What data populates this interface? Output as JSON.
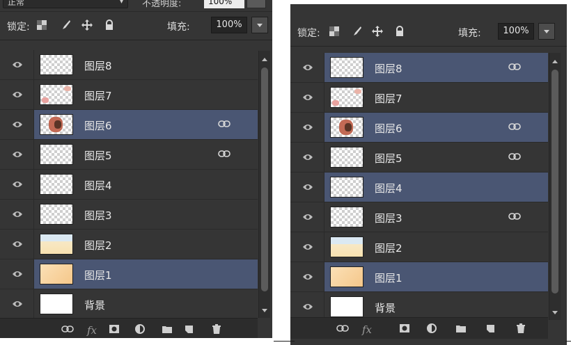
{
  "left_panel": {
    "blend_mode": "正常",
    "opacity_label": "不透明度:",
    "opacity_value": "100%",
    "lock_label": "锁定:",
    "fill_label": "填充:",
    "fill_value": "100%",
    "layers": [
      {
        "name": "图层8",
        "thumb": "checker",
        "linked": false,
        "selected": false
      },
      {
        "name": "图层7",
        "thumb": "checker-floral",
        "linked": false,
        "selected": false
      },
      {
        "name": "图层6",
        "thumb": "photo-figure",
        "linked": true,
        "selected": true
      },
      {
        "name": "图层5",
        "thumb": "checker",
        "linked": true,
        "selected": false
      },
      {
        "name": "图层4",
        "thumb": "checker",
        "linked": false,
        "selected": false
      },
      {
        "name": "图层3",
        "thumb": "checker",
        "linked": false,
        "selected": false
      },
      {
        "name": "图层2",
        "thumb": "banner",
        "linked": false,
        "selected": false
      },
      {
        "name": "图层1",
        "thumb": "warm",
        "linked": false,
        "selected": true
      },
      {
        "name": "背景",
        "thumb": "white",
        "linked": false,
        "selected": false
      }
    ]
  },
  "right_panel": {
    "lock_label": "锁定:",
    "fill_label": "填充:",
    "fill_value": "100%",
    "layers": [
      {
        "name": "图层8",
        "thumb": "checker",
        "linked": true,
        "selected": true
      },
      {
        "name": "图层7",
        "thumb": "checker-floral",
        "linked": false,
        "selected": false
      },
      {
        "name": "图层6",
        "thumb": "photo-figure",
        "linked": true,
        "selected": true
      },
      {
        "name": "图层5",
        "thumb": "checker",
        "linked": true,
        "selected": false
      },
      {
        "name": "图层4",
        "thumb": "checker",
        "linked": false,
        "selected": true
      },
      {
        "name": "图层3",
        "thumb": "checker",
        "linked": true,
        "selected": false
      },
      {
        "name": "图层2",
        "thumb": "banner",
        "linked": false,
        "selected": false
      },
      {
        "name": "图层1",
        "thumb": "warm",
        "linked": false,
        "selected": true
      },
      {
        "name": "背景",
        "thumb": "white",
        "linked": false,
        "selected": false
      }
    ]
  },
  "icons": {
    "lock": [
      "lock-transparent-pixels-icon",
      "lock-image-pixels-icon",
      "lock-position-icon",
      "lock-all-icon"
    ],
    "layer_row": [
      "visibility-eye-icon",
      "layer-link-icon"
    ],
    "toolbar": [
      "link-layers-icon",
      "fx-icon",
      "add-mask-icon",
      "adjustment-layer-icon",
      "new-group-icon",
      "new-layer-icon",
      "delete-layer-icon"
    ]
  },
  "colors": {
    "panel_bg": "#353535",
    "selected_row": "#4a5673",
    "text": "#e8e8e8"
  }
}
